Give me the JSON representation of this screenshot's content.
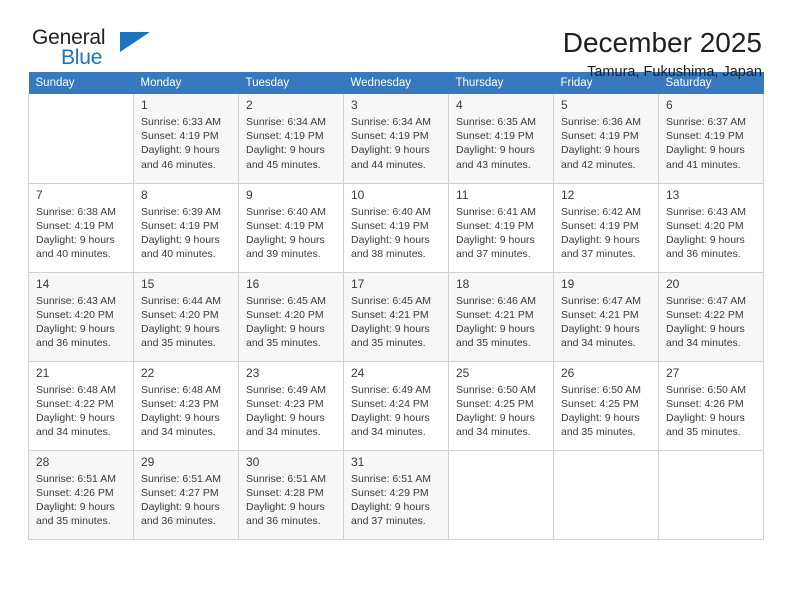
{
  "logo": {
    "word1": "General",
    "word2": "Blue",
    "triangle_color": "#1c75bc",
    "icon": "triangle-icon"
  },
  "header": {
    "title": "December 2025",
    "subtitle": "Tamura, Fukushima, Japan"
  },
  "colors": {
    "header_row_bg": "#3679bf",
    "header_row_text": "#ffffff",
    "shaded_row_bg": "#f7f7f7",
    "cell_border": "#d2d2d2",
    "text": "#3b3b3b",
    "brand_blue": "#1c75bc"
  },
  "weekdays": [
    "Sunday",
    "Monday",
    "Tuesday",
    "Wednesday",
    "Thursday",
    "Friday",
    "Saturday"
  ],
  "weeks": [
    [
      {
        "day": "",
        "sunrise": "",
        "sunset": "",
        "daylight1": "",
        "daylight2": ""
      },
      {
        "day": "1",
        "sunrise": "Sunrise: 6:33 AM",
        "sunset": "Sunset: 4:19 PM",
        "daylight1": "Daylight: 9 hours",
        "daylight2": "and 46 minutes."
      },
      {
        "day": "2",
        "sunrise": "Sunrise: 6:34 AM",
        "sunset": "Sunset: 4:19 PM",
        "daylight1": "Daylight: 9 hours",
        "daylight2": "and 45 minutes."
      },
      {
        "day": "3",
        "sunrise": "Sunrise: 6:34 AM",
        "sunset": "Sunset: 4:19 PM",
        "daylight1": "Daylight: 9 hours",
        "daylight2": "and 44 minutes."
      },
      {
        "day": "4",
        "sunrise": "Sunrise: 6:35 AM",
        "sunset": "Sunset: 4:19 PM",
        "daylight1": "Daylight: 9 hours",
        "daylight2": "and 43 minutes."
      },
      {
        "day": "5",
        "sunrise": "Sunrise: 6:36 AM",
        "sunset": "Sunset: 4:19 PM",
        "daylight1": "Daylight: 9 hours",
        "daylight2": "and 42 minutes."
      },
      {
        "day": "6",
        "sunrise": "Sunrise: 6:37 AM",
        "sunset": "Sunset: 4:19 PM",
        "daylight1": "Daylight: 9 hours",
        "daylight2": "and 41 minutes."
      }
    ],
    [
      {
        "day": "7",
        "sunrise": "Sunrise: 6:38 AM",
        "sunset": "Sunset: 4:19 PM",
        "daylight1": "Daylight: 9 hours",
        "daylight2": "and 40 minutes."
      },
      {
        "day": "8",
        "sunrise": "Sunrise: 6:39 AM",
        "sunset": "Sunset: 4:19 PM",
        "daylight1": "Daylight: 9 hours",
        "daylight2": "and 40 minutes."
      },
      {
        "day": "9",
        "sunrise": "Sunrise: 6:40 AM",
        "sunset": "Sunset: 4:19 PM",
        "daylight1": "Daylight: 9 hours",
        "daylight2": "and 39 minutes."
      },
      {
        "day": "10",
        "sunrise": "Sunrise: 6:40 AM",
        "sunset": "Sunset: 4:19 PM",
        "daylight1": "Daylight: 9 hours",
        "daylight2": "and 38 minutes."
      },
      {
        "day": "11",
        "sunrise": "Sunrise: 6:41 AM",
        "sunset": "Sunset: 4:19 PM",
        "daylight1": "Daylight: 9 hours",
        "daylight2": "and 37 minutes."
      },
      {
        "day": "12",
        "sunrise": "Sunrise: 6:42 AM",
        "sunset": "Sunset: 4:19 PM",
        "daylight1": "Daylight: 9 hours",
        "daylight2": "and 37 minutes."
      },
      {
        "day": "13",
        "sunrise": "Sunrise: 6:43 AM",
        "sunset": "Sunset: 4:20 PM",
        "daylight1": "Daylight: 9 hours",
        "daylight2": "and 36 minutes."
      }
    ],
    [
      {
        "day": "14",
        "sunrise": "Sunrise: 6:43 AM",
        "sunset": "Sunset: 4:20 PM",
        "daylight1": "Daylight: 9 hours",
        "daylight2": "and 36 minutes."
      },
      {
        "day": "15",
        "sunrise": "Sunrise: 6:44 AM",
        "sunset": "Sunset: 4:20 PM",
        "daylight1": "Daylight: 9 hours",
        "daylight2": "and 35 minutes."
      },
      {
        "day": "16",
        "sunrise": "Sunrise: 6:45 AM",
        "sunset": "Sunset: 4:20 PM",
        "daylight1": "Daylight: 9 hours",
        "daylight2": "and 35 minutes."
      },
      {
        "day": "17",
        "sunrise": "Sunrise: 6:45 AM",
        "sunset": "Sunset: 4:21 PM",
        "daylight1": "Daylight: 9 hours",
        "daylight2": "and 35 minutes."
      },
      {
        "day": "18",
        "sunrise": "Sunrise: 6:46 AM",
        "sunset": "Sunset: 4:21 PM",
        "daylight1": "Daylight: 9 hours",
        "daylight2": "and 35 minutes."
      },
      {
        "day": "19",
        "sunrise": "Sunrise: 6:47 AM",
        "sunset": "Sunset: 4:21 PM",
        "daylight1": "Daylight: 9 hours",
        "daylight2": "and 34 minutes."
      },
      {
        "day": "20",
        "sunrise": "Sunrise: 6:47 AM",
        "sunset": "Sunset: 4:22 PM",
        "daylight1": "Daylight: 9 hours",
        "daylight2": "and 34 minutes."
      }
    ],
    [
      {
        "day": "21",
        "sunrise": "Sunrise: 6:48 AM",
        "sunset": "Sunset: 4:22 PM",
        "daylight1": "Daylight: 9 hours",
        "daylight2": "and 34 minutes."
      },
      {
        "day": "22",
        "sunrise": "Sunrise: 6:48 AM",
        "sunset": "Sunset: 4:23 PM",
        "daylight1": "Daylight: 9 hours",
        "daylight2": "and 34 minutes."
      },
      {
        "day": "23",
        "sunrise": "Sunrise: 6:49 AM",
        "sunset": "Sunset: 4:23 PM",
        "daylight1": "Daylight: 9 hours",
        "daylight2": "and 34 minutes."
      },
      {
        "day": "24",
        "sunrise": "Sunrise: 6:49 AM",
        "sunset": "Sunset: 4:24 PM",
        "daylight1": "Daylight: 9 hours",
        "daylight2": "and 34 minutes."
      },
      {
        "day": "25",
        "sunrise": "Sunrise: 6:50 AM",
        "sunset": "Sunset: 4:25 PM",
        "daylight1": "Daylight: 9 hours",
        "daylight2": "and 34 minutes."
      },
      {
        "day": "26",
        "sunrise": "Sunrise: 6:50 AM",
        "sunset": "Sunset: 4:25 PM",
        "daylight1": "Daylight: 9 hours",
        "daylight2": "and 35 minutes."
      },
      {
        "day": "27",
        "sunrise": "Sunrise: 6:50 AM",
        "sunset": "Sunset: 4:26 PM",
        "daylight1": "Daylight: 9 hours",
        "daylight2": "and 35 minutes."
      }
    ],
    [
      {
        "day": "28",
        "sunrise": "Sunrise: 6:51 AM",
        "sunset": "Sunset: 4:26 PM",
        "daylight1": "Daylight: 9 hours",
        "daylight2": "and 35 minutes."
      },
      {
        "day": "29",
        "sunrise": "Sunrise: 6:51 AM",
        "sunset": "Sunset: 4:27 PM",
        "daylight1": "Daylight: 9 hours",
        "daylight2": "and 36 minutes."
      },
      {
        "day": "30",
        "sunrise": "Sunrise: 6:51 AM",
        "sunset": "Sunset: 4:28 PM",
        "daylight1": "Daylight: 9 hours",
        "daylight2": "and 36 minutes."
      },
      {
        "day": "31",
        "sunrise": "Sunrise: 6:51 AM",
        "sunset": "Sunset: 4:29 PM",
        "daylight1": "Daylight: 9 hours",
        "daylight2": "and 37 minutes."
      },
      {
        "day": "",
        "sunrise": "",
        "sunset": "",
        "daylight1": "",
        "daylight2": ""
      },
      {
        "day": "",
        "sunrise": "",
        "sunset": "",
        "daylight1": "",
        "daylight2": ""
      },
      {
        "day": "",
        "sunrise": "",
        "sunset": "",
        "daylight1": "",
        "daylight2": ""
      }
    ]
  ]
}
